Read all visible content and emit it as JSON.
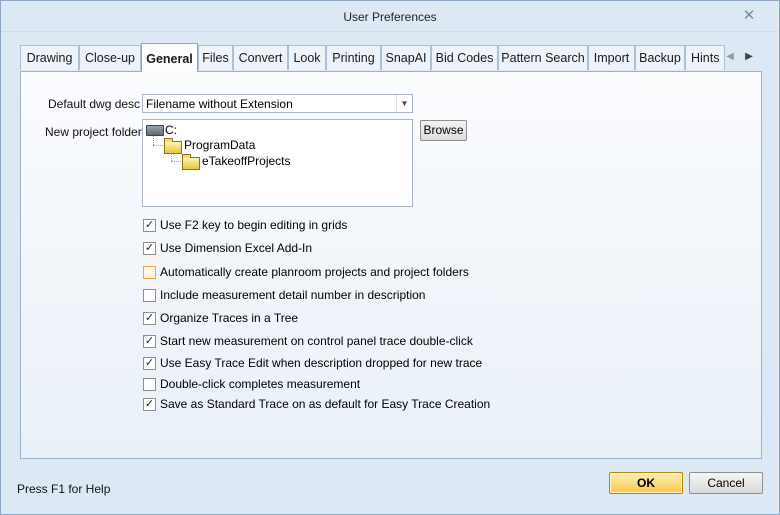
{
  "window": {
    "title": "User Preferences",
    "close_glyph": "✕"
  },
  "tabs": [
    {
      "label": "Drawing"
    },
    {
      "label": "Close-up"
    },
    {
      "label": "General",
      "active": true
    },
    {
      "label": "Files"
    },
    {
      "label": "Convert"
    },
    {
      "label": "Look"
    },
    {
      "label": "Printing"
    },
    {
      "label": "SnapAI"
    },
    {
      "label": "Bid Codes"
    },
    {
      "label": "Pattern Search"
    },
    {
      "label": "Import"
    },
    {
      "label": "Backup"
    },
    {
      "label": "Hints"
    }
  ],
  "tab_scroll": {
    "left": "◀",
    "right": "▶"
  },
  "general": {
    "dwg_desc_label": "Default dwg desc :",
    "dwg_desc_value": "Filename without Extension",
    "project_folder_label": "New project folder :",
    "browse_label": "Browse",
    "folder_tree": [
      {
        "label": "C:",
        "type": "drive",
        "level": 0
      },
      {
        "label": "ProgramData",
        "type": "folder",
        "level": 1
      },
      {
        "label": "eTakeoffProjects",
        "type": "folder",
        "level": 2
      }
    ],
    "options": [
      {
        "label": "Use F2 key to begin editing in grids",
        "checked": true
      },
      {
        "label": "Use Dimension Excel Add-In",
        "checked": true
      },
      {
        "label": "Automatically create planroom projects and project folders",
        "checked": false,
        "focused": true
      },
      {
        "label": "Include measurement detail number in description",
        "checked": false
      },
      {
        "label": "Organize Traces in a Tree",
        "checked": true
      },
      {
        "label": "Start new measurement on control panel trace double-click",
        "checked": true
      },
      {
        "label": "Use Easy Trace Edit when description dropped for new trace",
        "checked": true
      },
      {
        "label": "Double-click completes measurement",
        "checked": false
      },
      {
        "label": "Save as Standard Trace on as default for Easy Trace Creation",
        "checked": true
      }
    ]
  },
  "footer": {
    "help_text": "Press F1 for Help",
    "ok_label": "OK",
    "cancel_label": "Cancel"
  },
  "colors": {
    "window_bg": "#dde8f5",
    "ok_button": "#f7c948",
    "focus_border": "#f0a640"
  }
}
